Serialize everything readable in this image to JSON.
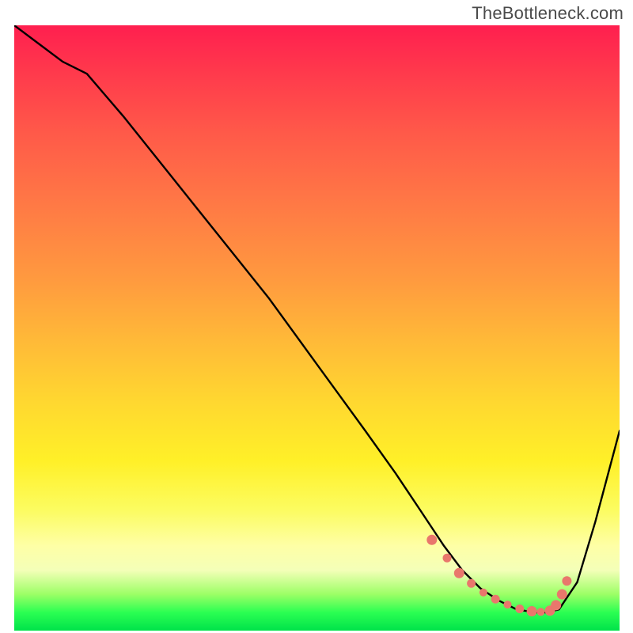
{
  "watermark": "TheBottleneck.com",
  "colors": {
    "curve": "#000000",
    "marker": "#e9776c"
  },
  "chart_data": {
    "type": "line",
    "title": "",
    "xlabel": "",
    "ylabel": "",
    "xlim": [
      0,
      100
    ],
    "ylim": [
      0,
      100
    ],
    "grid": false,
    "legend": false,
    "series": [
      {
        "name": "bottleneck-curve",
        "x": [
          0,
          4,
          8,
          12,
          18,
          26,
          34,
          42,
          50,
          58,
          63,
          67,
          71,
          74,
          77,
          80,
          83,
          86,
          88,
          90,
          93,
          96,
          100
        ],
        "y": [
          100,
          97,
          94,
          92,
          85,
          75,
          65,
          55,
          44,
          33,
          26,
          20,
          14,
          10,
          7,
          5,
          3.5,
          3,
          3,
          3.5,
          8,
          18,
          33
        ]
      }
    ],
    "markers": {
      "name": "optimal-zone",
      "x": [
        69,
        71.5,
        73.5,
        75.5,
        77.5,
        79.5,
        81.5,
        83.5,
        85.5,
        87,
        88.5,
        89.5,
        90.5,
        91.3
      ],
      "y": [
        15,
        12,
        9.5,
        7.8,
        6.3,
        5.2,
        4.3,
        3.6,
        3.2,
        3.1,
        3.3,
        4.2,
        6.0,
        8.2
      ],
      "r": [
        6.5,
        5.5,
        6.5,
        5.5,
        5.0,
        5.5,
        5.0,
        5.5,
        6.5,
        5.0,
        6.5,
        6.5,
        6.5,
        6.0
      ]
    }
  }
}
